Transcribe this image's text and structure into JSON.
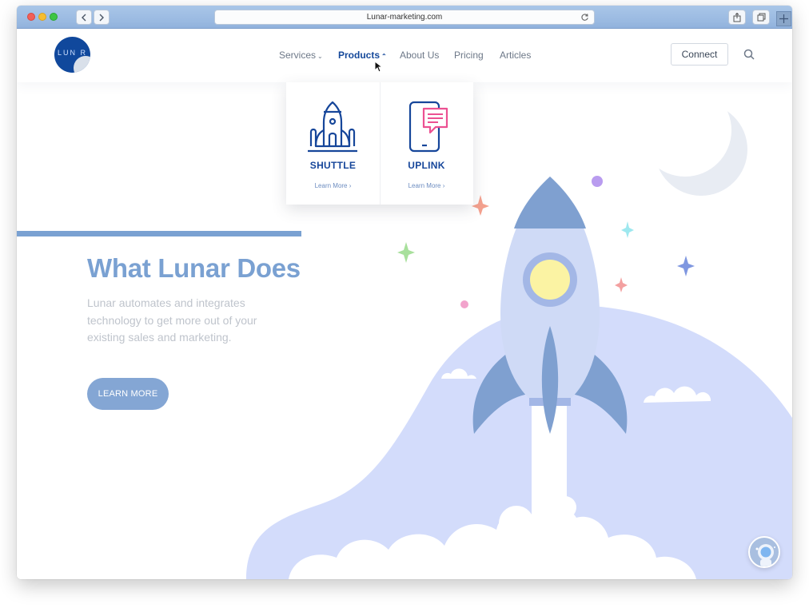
{
  "browser": {
    "url": "Lunar-marketing.com"
  },
  "logo": {
    "text": "LUN R"
  },
  "nav": {
    "items": [
      {
        "label": "Services"
      },
      {
        "label": "Products"
      },
      {
        "label": "About Us"
      },
      {
        "label": "Pricing"
      },
      {
        "label": "Articles"
      }
    ],
    "active": "Products",
    "connect_label": "Connect"
  },
  "dropdown": {
    "products": [
      {
        "title": "SHUTTLE",
        "link": "Learn More ›",
        "icon": "rocket-icon"
      },
      {
        "title": "UPLINK",
        "link": "Learn More ›",
        "icon": "phone-chat-icon"
      }
    ]
  },
  "hero": {
    "title": "What Lunar Does",
    "subtitle": "Lunar automates and integrates technology to get more out of your existing sales and marketing.",
    "cta_label": "LEARN MORE"
  },
  "colors": {
    "brand_blue": "#14489a",
    "accent": "#7aa1d2",
    "hill": "#d3dcfb",
    "rocket_dark": "#7fa0d0"
  }
}
